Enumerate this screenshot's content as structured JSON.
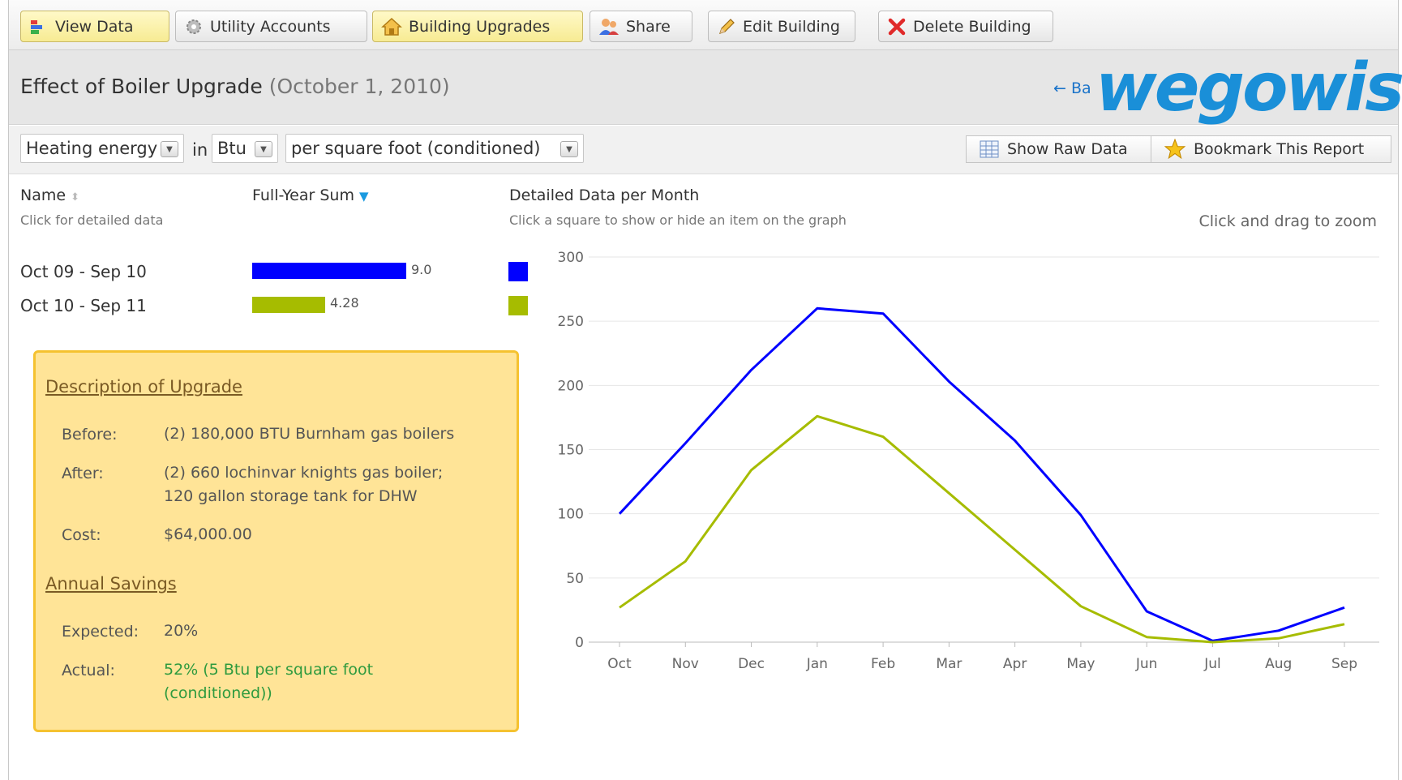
{
  "toolbar": {
    "buttons": [
      {
        "label": "View Data"
      },
      {
        "label": "Utility Accounts"
      },
      {
        "label": "Building Upgrades"
      },
      {
        "label": "Share"
      },
      {
        "label": "Edit Building"
      },
      {
        "label": "Delete Building"
      }
    ]
  },
  "header": {
    "title": "Effect of Boiler Upgrade",
    "date": "(October 1, 2010)",
    "back_link": "← Ba",
    "logo_text": "wegowise"
  },
  "filters": {
    "metric": "Heating energy",
    "in_label": "in",
    "unit": "Btu",
    "normalization": "per square foot (conditioned)",
    "show_raw_data": "Show Raw Data",
    "bookmark": "Bookmark This Report"
  },
  "columns": {
    "name": "Name",
    "name_sub": "Click for detailed data",
    "sum": "Full-Year Sum",
    "detail": "Detailed Data per Month",
    "detail_sub": "Click a square to show or hide an item on the graph",
    "zoom_hint": "Click and drag to zoom"
  },
  "rows": [
    {
      "name": "Oct 09 - Sep 10",
      "sum": "9.0",
      "sum_fraction": 1.0,
      "color": "#0000ff"
    },
    {
      "name": "Oct 10 - Sep 11",
      "sum": "4.28",
      "sum_fraction": 0.475,
      "color": "#a6bc00"
    }
  ],
  "upgrade": {
    "description_title": "Description of Upgrade",
    "before_label": "Before:",
    "before_value": "(2) 180,000 BTU Burnham gas boilers",
    "after_label": "After:",
    "after_value_line1": "(2) 660 lochinvar knights gas boiler;",
    "after_value_line2": "120 gallon storage tank for DHW",
    "cost_label": "Cost:",
    "cost_value": "$64,000.00",
    "savings_title": "Annual Savings",
    "expected_label": "Expected:",
    "expected_value": "20%",
    "actual_label": "Actual:",
    "actual_value_line1": "52% (5 Btu per square foot",
    "actual_value_line2": "(conditioned))"
  },
  "chart_data": {
    "type": "line",
    "categories": [
      "Oct",
      "Nov",
      "Dec",
      "Jan",
      "Feb",
      "Mar",
      "Apr",
      "May",
      "Jun",
      "Jul",
      "Aug",
      "Sep"
    ],
    "ylim": [
      0,
      300
    ],
    "yticks": [
      "0",
      "50",
      "100",
      "150",
      "200",
      "250",
      "300"
    ],
    "grid": true,
    "series": [
      {
        "name": "Oct 09 - Sep 10",
        "color": "#0000ff",
        "values": [
          100,
          155,
          212,
          260,
          256,
          203,
          157,
          99,
          24,
          1,
          9,
          27
        ]
      },
      {
        "name": "Oct 10 - Sep 11",
        "color": "#a6bc00",
        "values": [
          27,
          63,
          134,
          176,
          160,
          116,
          72,
          28,
          4,
          0,
          3,
          14
        ]
      }
    ]
  }
}
